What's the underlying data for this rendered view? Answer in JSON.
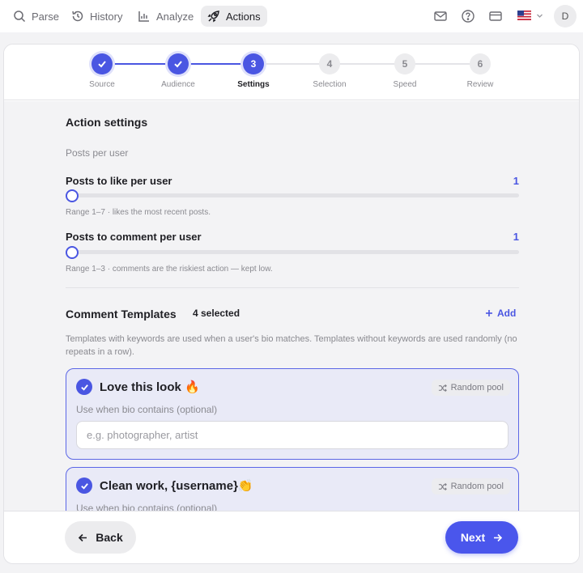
{
  "nav": {
    "items": [
      {
        "label": "Parse",
        "icon": "search-icon"
      },
      {
        "label": "History",
        "icon": "history-icon"
      },
      {
        "label": "Analyze",
        "icon": "bar-chart-icon"
      },
      {
        "label": "Actions",
        "icon": "rocket-icon",
        "active": true
      }
    ],
    "right_icons": [
      "mail-icon",
      "help-icon",
      "card-icon",
      "us-flag-icon"
    ],
    "avatar": "D"
  },
  "stepper": {
    "steps": [
      {
        "number": "1",
        "label": "Source",
        "state": "done"
      },
      {
        "number": "2",
        "label": "Audience",
        "state": "done"
      },
      {
        "number": "3",
        "label": "Settings",
        "state": "current"
      },
      {
        "number": "4",
        "label": "Selection",
        "state": "todo"
      },
      {
        "number": "5",
        "label": "Speed",
        "state": "todo"
      },
      {
        "number": "6",
        "label": "Review",
        "state": "todo"
      }
    ]
  },
  "settings": {
    "title": "Action settings",
    "group_label": "Posts per user",
    "like": {
      "label": "Posts to like per user",
      "value": "1",
      "min": 1,
      "max": 7,
      "hint": "Range 1–7 · likes the most recent posts."
    },
    "comment": {
      "label": "Posts to comment per user",
      "value": "1",
      "min": 1,
      "max": 3,
      "hint": "Range 1–3 · comments are the riskiest action — kept low."
    }
  },
  "templates": {
    "title": "Comment Templates",
    "selected": "4 selected",
    "add_label": "Add",
    "description": "Templates with keywords are used when a user's bio matches. Templates without keywords are used randomly (no repeats in a row).",
    "items": [
      {
        "title": "Love this look 🔥",
        "badge": "Random pool",
        "sub": "Use when bio contains (optional)",
        "placeholder": "e.g. photographer, artist",
        "value": ""
      },
      {
        "title": "Clean work, {username}👏",
        "badge": "Random pool",
        "sub": "Use when bio contains (optional)"
      }
    ]
  },
  "footer": {
    "back": "Back",
    "next": "Next"
  },
  "colors": {
    "accent": "#4a56e2",
    "background": "#f3f3f5"
  }
}
